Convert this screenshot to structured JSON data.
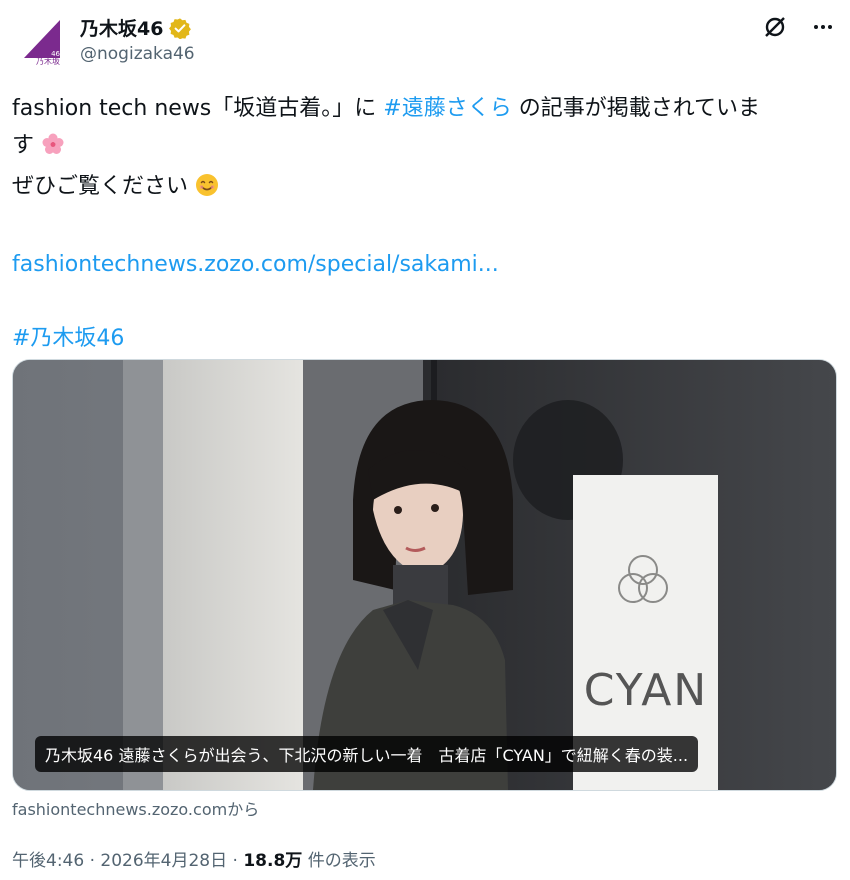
{
  "account": {
    "display_name": "乃木坂46",
    "handle": "@nogizaka46",
    "logo_text": "乃木坂",
    "logo_number": "46"
  },
  "post": {
    "line1_prefix": "fashion tech news「坂道古着。」に ",
    "line1_hashtag": "#遠藤さくら",
    "line1_suffix": " の記事が掲載されていま",
    "line2_text": "す",
    "line3_text": "ぜひご覧ください",
    "link": "fashiontechnews.zozo.com/special/sakami...",
    "hashtag": "#乃木坂46"
  },
  "card": {
    "caption": "乃木坂46 遠藤さくらが出会う、下北沢の新しい一着　古着店「CYAN」で紐解く春の装...",
    "sign_text": "CYAN",
    "source": "fashiontechnews.zozo.comから"
  },
  "meta": {
    "time": "午後4:46",
    "separator": " · ",
    "date": "2026年4月28日",
    "views_count": "18.8万",
    "views_label": " 件の表示"
  },
  "colors": {
    "link": "#1d9bf0",
    "logo_purple": "#7b2a8e",
    "verified_gold": "#e2b719"
  }
}
